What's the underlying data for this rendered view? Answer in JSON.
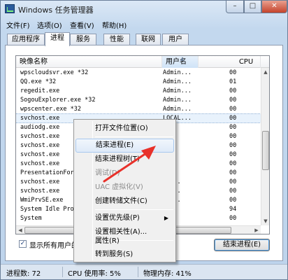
{
  "window": {
    "title": "Windows 任务管理器",
    "controls": {
      "minimize": "–",
      "maximize": "□",
      "close": "✕"
    }
  },
  "menubar": [
    "文件(F)",
    "选项(O)",
    "查看(V)",
    "帮助(H)"
  ],
  "tabs": [
    "应用程序",
    "进程",
    "服务",
    "性能",
    "联网",
    "用户"
  ],
  "active_tab": "进程",
  "columns": {
    "name": "映像名称",
    "user": "用户名",
    "cpu": "CPU"
  },
  "processes": [
    {
      "name": "wpscloudsvr.exe *32",
      "user": "Admin...",
      "cpu": "00"
    },
    {
      "name": "QQ.exe *32",
      "user": "Admin...",
      "cpu": "01"
    },
    {
      "name": "regedit.exe",
      "user": "Admin...",
      "cpu": "00"
    },
    {
      "name": "SogouExplorer.exe *32",
      "user": "Admin...",
      "cpu": "00"
    },
    {
      "name": "wpscenter.exe *32",
      "user": "Admin...",
      "cpu": "00"
    },
    {
      "name": "svchost.exe",
      "user": "LOCAL...",
      "cpu": "00"
    },
    {
      "name": "audiodg.exe",
      "user": "",
      "cpu": "00"
    },
    {
      "name": "svchost.exe",
      "user": "",
      "cpu": "00"
    },
    {
      "name": "svchost.exe",
      "user": "",
      "cpu": "00"
    },
    {
      "name": "svchost.exe",
      "user": "",
      "cpu": "00"
    },
    {
      "name": "svchost.exe",
      "user": "",
      "cpu": "00"
    },
    {
      "name": "PresentationFor",
      "user": "",
      "cpu": "00"
    },
    {
      "name": "svchost.exe",
      "user": "WO...",
      "cpu": "00"
    },
    {
      "name": "svchost.exe",
      "user": "WO...",
      "cpu": "00"
    },
    {
      "name": "WmiPrvSE.exe",
      "user": "WO...",
      "cpu": "00"
    },
    {
      "name": "System Idle Pro",
      "user": "TEM",
      "cpu": "94"
    },
    {
      "name": "System",
      "user": "TEM",
      "cpu": "00"
    }
  ],
  "context_menu": {
    "items": [
      {
        "label": "打开文件位置(O)",
        "state": "normal"
      },
      {
        "label": "结束进程(E)",
        "state": "hover"
      },
      {
        "label": "结束进程树(T)",
        "state": "normal"
      },
      {
        "label": "调试(D)",
        "state": "disabled"
      },
      {
        "label": "UAC 虚拟化(V)",
        "state": "disabled"
      },
      {
        "label": "创建转储文件(C)",
        "state": "normal"
      },
      {
        "label": "设置优先级(P)",
        "state": "normal",
        "submenu": "▶"
      },
      {
        "label": "设置相关性(A)...",
        "state": "normal"
      },
      {
        "label": "属性(R)",
        "state": "normal"
      },
      {
        "label": "转到服务(S)",
        "state": "normal"
      }
    ]
  },
  "show_all_label": "显示所有用户的进程(S)",
  "show_all_checked": true,
  "checkmark": "✓",
  "end_process_button": "结束进程(E)",
  "statusbar": {
    "processes": "进程数: 72",
    "cpu": "CPU 使用率: 5%",
    "memory": "物理内存: 41%"
  },
  "colors": {
    "annotation_arrow": "#e8312a",
    "selection": "#e8f2fc",
    "menu_hover": "#dfeaf8"
  }
}
